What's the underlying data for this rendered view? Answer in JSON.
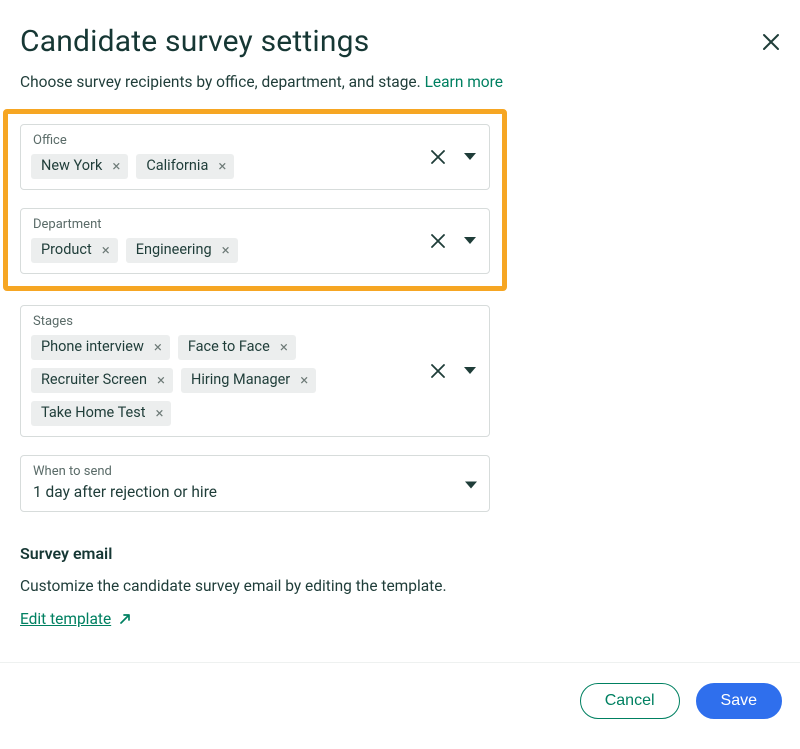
{
  "header": {
    "title": "Candidate survey settings",
    "description": "Choose survey recipients by office, department, and stage. ",
    "learn_more": "Learn more"
  },
  "fields": {
    "office": {
      "label": "Office",
      "chips": [
        "New York",
        "California"
      ]
    },
    "department": {
      "label": "Department",
      "chips": [
        "Product",
        "Engineering"
      ]
    },
    "stages": {
      "label": "Stages",
      "chips": [
        "Phone interview",
        "Face to Face",
        "Recruiter Screen",
        "Hiring Manager",
        "Take Home Test"
      ]
    },
    "when_to_send": {
      "label": "When to send",
      "value": "1 day after rejection or hire"
    }
  },
  "survey_email": {
    "heading": "Survey email",
    "description": "Customize the candidate survey email by editing the template.",
    "edit_link": "Edit template"
  },
  "footer": {
    "cancel": "Cancel",
    "save": "Save"
  },
  "icons": {
    "close": "close-icon",
    "clear": "clear-icon",
    "caret": "caret-down-icon",
    "external": "external-link-icon",
    "chip_x": "×"
  }
}
